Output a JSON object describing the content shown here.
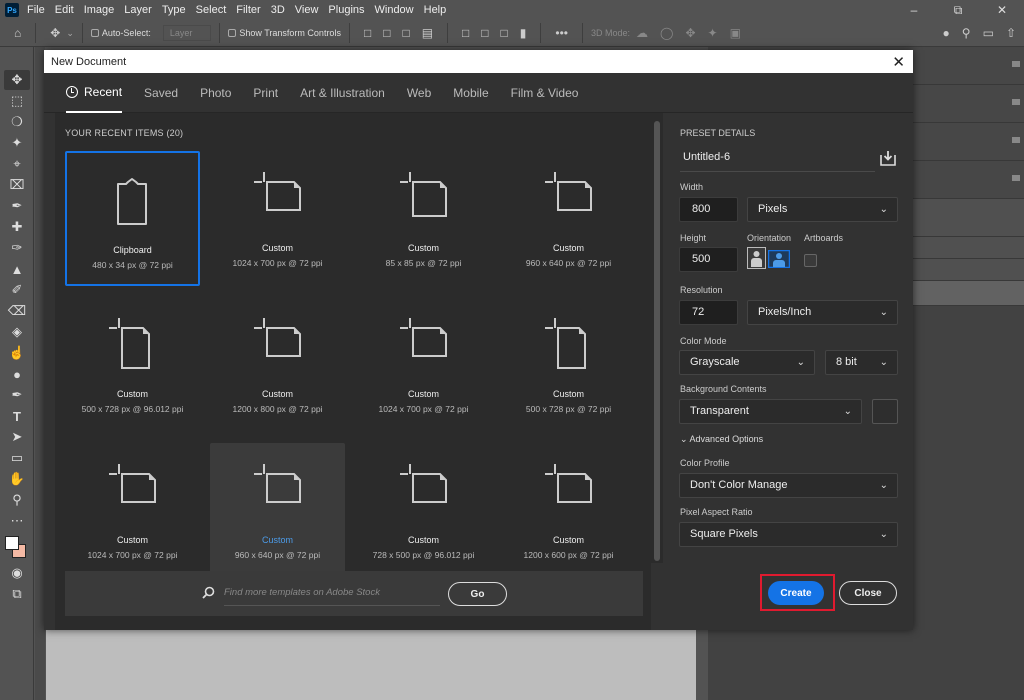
{
  "app": {
    "logo": "Ps",
    "menu": [
      "File",
      "Edit",
      "Image",
      "Layer",
      "Type",
      "Select",
      "Filter",
      "3D",
      "View",
      "Plugins",
      "Window",
      "Help"
    ]
  },
  "options_bar": {
    "auto_select_label": "Auto-Select:",
    "layer_select": "Layer",
    "show_transform": "Show Transform Controls",
    "mode_3d": "3D Mode:",
    "more": "•••"
  },
  "dialog": {
    "title": "New Document",
    "tabs": [
      "Recent",
      "Saved",
      "Photo",
      "Print",
      "Art & Illustration",
      "Web",
      "Mobile",
      "Film & Video"
    ],
    "recent_header": "YOUR RECENT ITEMS  (20)",
    "items": [
      {
        "name": "Clipboard",
        "size": "480 x 34 px @ 72 ppi",
        "icon": "clipboard"
      },
      {
        "name": "Custom",
        "size": "1024 x 700 px @ 72 ppi",
        "icon": "landscape"
      },
      {
        "name": "Custom",
        "size": "85 x 85 px @ 72 ppi",
        "icon": "square"
      },
      {
        "name": "Custom",
        "size": "960 x 640 px @ 72 ppi",
        "icon": "landscape"
      },
      {
        "name": "Custom",
        "size": "500 x 728 px @ 96.012 ppi",
        "icon": "portrait"
      },
      {
        "name": "Custom",
        "size": "1200 x 800 px @ 72 ppi",
        "icon": "landscape"
      },
      {
        "name": "Custom",
        "size": "1024 x 700 px @ 72 ppi",
        "icon": "landscape"
      },
      {
        "name": "Custom",
        "size": "500 x 728 px @ 72 ppi",
        "icon": "portrait"
      },
      {
        "name": "Custom",
        "size": "1024 x 700 px @ 72 ppi",
        "icon": "landscape"
      },
      {
        "name": "Custom",
        "size": "960 x 640 px @ 72 ppi",
        "icon": "landscape"
      },
      {
        "name": "Custom",
        "size": "728 x 500 px @ 96.012 ppi",
        "icon": "landscape"
      },
      {
        "name": "Custom",
        "size": "1200 x 600 px @ 72 ppi",
        "icon": "landscape"
      }
    ],
    "search_placeholder": "Find more templates on Adobe Stock",
    "go_label": "Go",
    "preset": {
      "header": "PRESET DETAILS",
      "name": "Untitled-6",
      "width_label": "Width",
      "width": "800",
      "width_unit": "Pixels",
      "height_label": "Height",
      "height": "500",
      "orientation_label": "Orientation",
      "artboards_label": "Artboards",
      "resolution_label": "Resolution",
      "resolution": "72",
      "resolution_unit": "Pixels/Inch",
      "color_mode_label": "Color Mode",
      "color_mode": "Grayscale",
      "bit_depth": "8 bit",
      "bg_label": "Background Contents",
      "bg": "Transparent",
      "advanced": "Advanced Options",
      "profile_label": "Color Profile",
      "profile": "Don't Color Manage",
      "par_label": "Pixel Aspect Ratio",
      "par": "Square Pixels"
    },
    "create_label": "Create",
    "close_label": "Close"
  },
  "colors": {
    "accent": "#1473e6",
    "highlight": "#e01a2f",
    "swatch_bg": "#f4b9a4"
  }
}
